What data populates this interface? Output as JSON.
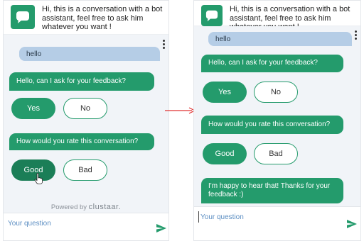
{
  "header": {
    "line1": "Hi, this is a conversation with a bot",
    "line2": "assistant, feel free to ask him",
    "line3": "whatever you want !"
  },
  "icons": {
    "bot": "chat-bubble-icon",
    "menu": "vertical-dots-icon",
    "send": "send-arrow-icon",
    "pointer": "hand-pointer-icon",
    "flow": "right-arrow-icon"
  },
  "colors": {
    "accent": "#249b6c",
    "user_bubble": "#b5cde6",
    "chat_background": "#f1f4f8",
    "arrow": "#e03030"
  },
  "before": {
    "user_message": "hello",
    "bot_question_1": "Hello, can I ask for your feedback?",
    "yes_label": "Yes",
    "no_label": "No",
    "bot_question_2": "How would you rate this conversation?",
    "good_label": "Good",
    "bad_label": "Bad",
    "powered_prefix": "Powered by",
    "powered_brand": "clustaar.",
    "input_placeholder": "Your question"
  },
  "after": {
    "user_message": "hello",
    "bot_question_1": "Hello, can I ask for your feedback?",
    "yes_label": "Yes",
    "no_label": "No",
    "bot_question_2": "How would you rate this conversation?",
    "good_label": "Good",
    "bad_label": "Bad",
    "bot_reply_line1": "I'm happy to hear that! Thanks for your",
    "bot_reply_line2": "feedback :)",
    "input_placeholder": "Your question"
  }
}
